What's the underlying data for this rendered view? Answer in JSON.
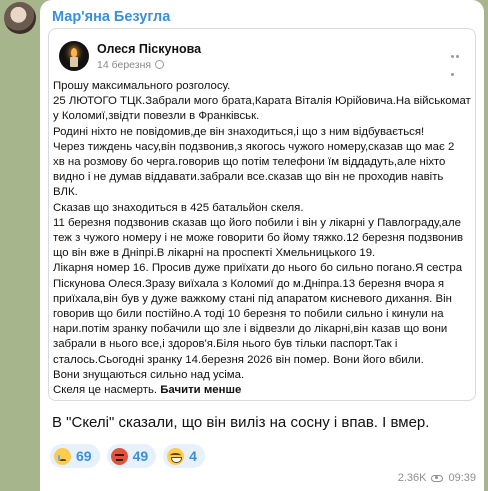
{
  "message": {
    "sender": "Мар'яна Безугла",
    "comment": "В \"Скелі\" сказали, що він виліз на сосну і впав. І вмер.",
    "views": "2.36K",
    "time": "09:39"
  },
  "forwarded_post": {
    "author": "Олеся Піскунова",
    "date": "14 березня",
    "lines": [
      "Прошу максимального розголосу.",
      "25 ЛЮТОГО ТЦК.Забрали мого брата,Карата Віталія Юрійовича.На військомат",
      "у Коломиї,звідти повезли в Франківськ.",
      "Родині ніхто не повідомив,де він знаходиться,і що з ним відбувається!",
      "Через тиждень часу,він подзвонив,з якогось чужого номеру,сказав що має 2",
      "хв на розмову бо черга.говорив що потім телефони їм віддадуть,але ніхто",
      "видно і не думав віддавати.забрали все.сказав що він не проходив навіть",
      "ВЛК.",
      "Сказав що знаходиться в 425 батальйон скеля.",
      "11 березня подзвонив сказав що його побили і він у лікарні у Павлограду,але",
      "теж з чужого номеру і не може говорити бо йому тяжко.12 березня подзвонив",
      "що він вже в Дніпрі.В лікарні на проспекті Хмельницького 19.",
      " Лікарня номер 16. Просив дуже приїхати до нього бо сильно погано.Я сестра",
      "Піскунова Олеся.Зразу виїхала з Коломиї до м.Дніпра.13 березня вчора я",
      "приїхала,він був у дуже важкому стані під апаратом кисневого дихання. Він",
      "говорив що били постійно.А тоді 10 березня то побили сильно і кинули на",
      "нари.потім зранку побачили що зле і відвезли до лікарні,він казав що вони",
      "забрали в нього все,і здоров'я.Біля нього був тільки паспорт.Так і",
      "сталось.Сьогодні зранку 14.березня 2026 він помер. Вони його вбили.",
      "Вони знущаються сильно над усіма.",
      "Скеля це насмерть."
    ],
    "show_less_label": "Бачити менше"
  },
  "reactions": [
    {
      "icon": "crying-face-icon",
      "count": "69"
    },
    {
      "icon": "angry-face-icon",
      "count": "49"
    },
    {
      "icon": "grinning-face-icon",
      "count": "4"
    }
  ]
}
